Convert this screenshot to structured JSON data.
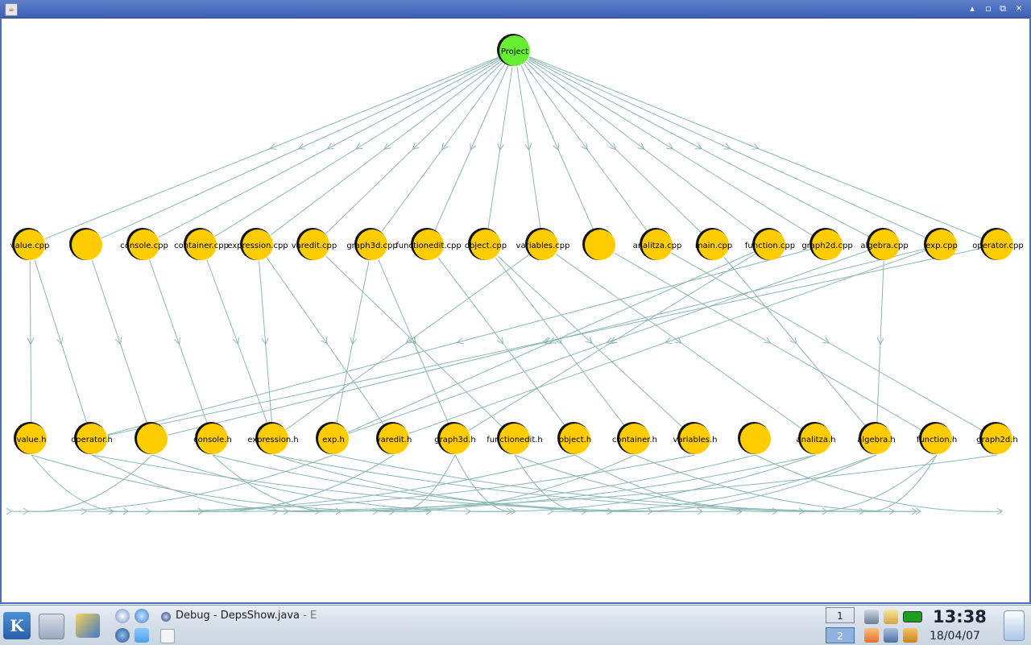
{
  "window": {
    "title": "",
    "controls": [
      "▴",
      "▫",
      "⧉",
      "✕"
    ]
  },
  "graph": {
    "root": {
      "id": "Project",
      "label": "Project",
      "color": "#66ee33"
    },
    "levels": [
      [
        {
          "id": "value.cpp",
          "label": "value.cpp"
        },
        {
          "id": "n1",
          "label": ""
        },
        {
          "id": "console.cpp",
          "label": "console.cpp"
        },
        {
          "id": "container.cpp",
          "label": "container.cpp"
        },
        {
          "id": "expression.cpp",
          "label": "expression.cpp"
        },
        {
          "id": "varedit.cpp",
          "label": "varedit.cpp"
        },
        {
          "id": "graph3d.cpp",
          "label": "graph3d.cpp"
        },
        {
          "id": "functionedit.cpp",
          "label": "functionedit.cpp"
        },
        {
          "id": "object.cpp",
          "label": "object.cpp"
        },
        {
          "id": "variables.cpp",
          "label": "variables.cpp"
        },
        {
          "id": "n2",
          "label": ""
        },
        {
          "id": "analitza.cpp",
          "label": "analitza.cpp"
        },
        {
          "id": "main.cpp",
          "label": "main.cpp"
        },
        {
          "id": "function.cpp",
          "label": "function.cpp"
        },
        {
          "id": "graph2d.cpp",
          "label": "graph2d.cpp"
        },
        {
          "id": "algebra.cpp",
          "label": "algebra.cpp"
        },
        {
          "id": "exp.cpp",
          "label": "exp.cpp"
        },
        {
          "id": "operator.cpp",
          "label": "operator.cpp"
        }
      ],
      [
        {
          "id": "value.h",
          "label": "value.h"
        },
        {
          "id": "operator.h",
          "label": "operator.h"
        },
        {
          "id": "n3",
          "label": ""
        },
        {
          "id": "console.h",
          "label": "console.h"
        },
        {
          "id": "expression.h",
          "label": "expression.h"
        },
        {
          "id": "exp.h",
          "label": "exp.h"
        },
        {
          "id": "varedit.h",
          "label": "varedit.h"
        },
        {
          "id": "graph3d.h",
          "label": "graph3d.h"
        },
        {
          "id": "functionedit.h",
          "label": "functionedit.h"
        },
        {
          "id": "object.h",
          "label": "object.h"
        },
        {
          "id": "container.h",
          "label": "container.h"
        },
        {
          "id": "variables.h",
          "label": "variables.h"
        },
        {
          "id": "n4",
          "label": ""
        },
        {
          "id": "analitza.h",
          "label": "analitza.h"
        },
        {
          "id": "algebra.h",
          "label": "algebra.h"
        },
        {
          "id": "function.h",
          "label": "function.h"
        },
        {
          "id": "graph2d.h",
          "label": "graph2d.h"
        }
      ]
    ],
    "edges": [
      [
        "value.cpp",
        "value.h"
      ],
      [
        "value.cpp",
        "operator.h"
      ],
      [
        "n1",
        "n3"
      ],
      [
        "console.cpp",
        "console.h"
      ],
      [
        "container.cpp",
        "expression.h"
      ],
      [
        "expression.cpp",
        "expression.h"
      ],
      [
        "expression.cpp",
        "varedit.h"
      ],
      [
        "varedit.cpp",
        "functionedit.h"
      ],
      [
        "graph3d.cpp",
        "exp.h"
      ],
      [
        "graph3d.cpp",
        "graph3d.h"
      ],
      [
        "functionedit.cpp",
        "object.h"
      ],
      [
        "object.cpp",
        "container.h"
      ],
      [
        "object.cpp",
        "variables.h"
      ],
      [
        "variables.cpp",
        "expression.h"
      ],
      [
        "variables.cpp",
        "analitza.h"
      ],
      [
        "n2",
        "function.h"
      ],
      [
        "analitza.cpp",
        "graph2d.h"
      ],
      [
        "main.cpp",
        "algebra.h"
      ],
      [
        "function.cpp",
        "exp.h"
      ],
      [
        "function.cpp",
        "graph3d.h"
      ],
      [
        "graph2d.cpp",
        "operator.h"
      ],
      [
        "algebra.cpp",
        "algebra.h"
      ],
      [
        "algebra.cpp",
        "exp.h"
      ],
      [
        "exp.cpp",
        "n3"
      ],
      [
        "exp.cpp",
        "varedit.h"
      ],
      [
        "operator.cpp",
        "operator.h"
      ]
    ],
    "colors": {
      "file_node": "#ffcc00",
      "edge": "#8ab8b4"
    }
  },
  "taskbar": {
    "task_label": "Debug - DepsShow.java",
    "task_suffix": "- E",
    "desktops": [
      "1",
      "2"
    ],
    "active_desktop": "2",
    "time": "13:38",
    "date": "18/04/07",
    "icons": [
      "kmenu-icon",
      "computer-icon",
      "desktop-icon",
      "konqueror-icon",
      "network-icon",
      "globe-icon",
      "kopete-icon",
      "java-icon",
      "volume-icon",
      "klipper-icon",
      "battery-icon",
      "ssh-icon",
      "signal-icon",
      "bag-icon",
      "trash-icon"
    ]
  }
}
